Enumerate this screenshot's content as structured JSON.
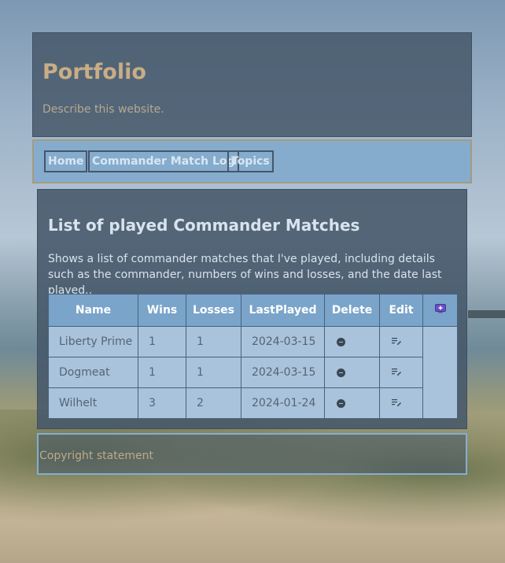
{
  "site": {
    "title": "Portfolio",
    "description": "Describe this website."
  },
  "nav": {
    "items": [
      {
        "label": "Home"
      },
      {
        "label": "Commander Match Log"
      },
      {
        "label": "Topics"
      }
    ]
  },
  "main": {
    "title": "List of played Commander Matches",
    "description": "Shows a list of commander matches that I've played, including details such as the commander, numbers of wins and losses, and the date last played..",
    "table": {
      "headers": {
        "name": "Name",
        "wins": "Wins",
        "losses": "Losses",
        "last_played": "LastPlayed",
        "delete": "Delete",
        "edit": "Edit"
      },
      "add_icon": "add-row-icon",
      "delete_icon": "minus-circle-icon",
      "edit_icon": "edit-list-icon",
      "rows": [
        {
          "name": "Liberty Prime",
          "wins": "1",
          "losses": "1",
          "last_played": "2024-03-15"
        },
        {
          "name": "Dogmeat",
          "wins": "1",
          "losses": "1",
          "last_played": "2024-03-15"
        },
        {
          "name": "Wilhelt",
          "wins": "3",
          "losses": "2",
          "last_played": "2024-01-24"
        }
      ]
    }
  },
  "footer": {
    "text": "Copyright statement"
  },
  "colors": {
    "title": "#c8ad86",
    "header_bg": "#46586a",
    "nav_bg": "#82aacd",
    "table_header": "#7aa4ca",
    "table_cell": "#a9c3dc",
    "add_icon": "#6a4fc0"
  }
}
